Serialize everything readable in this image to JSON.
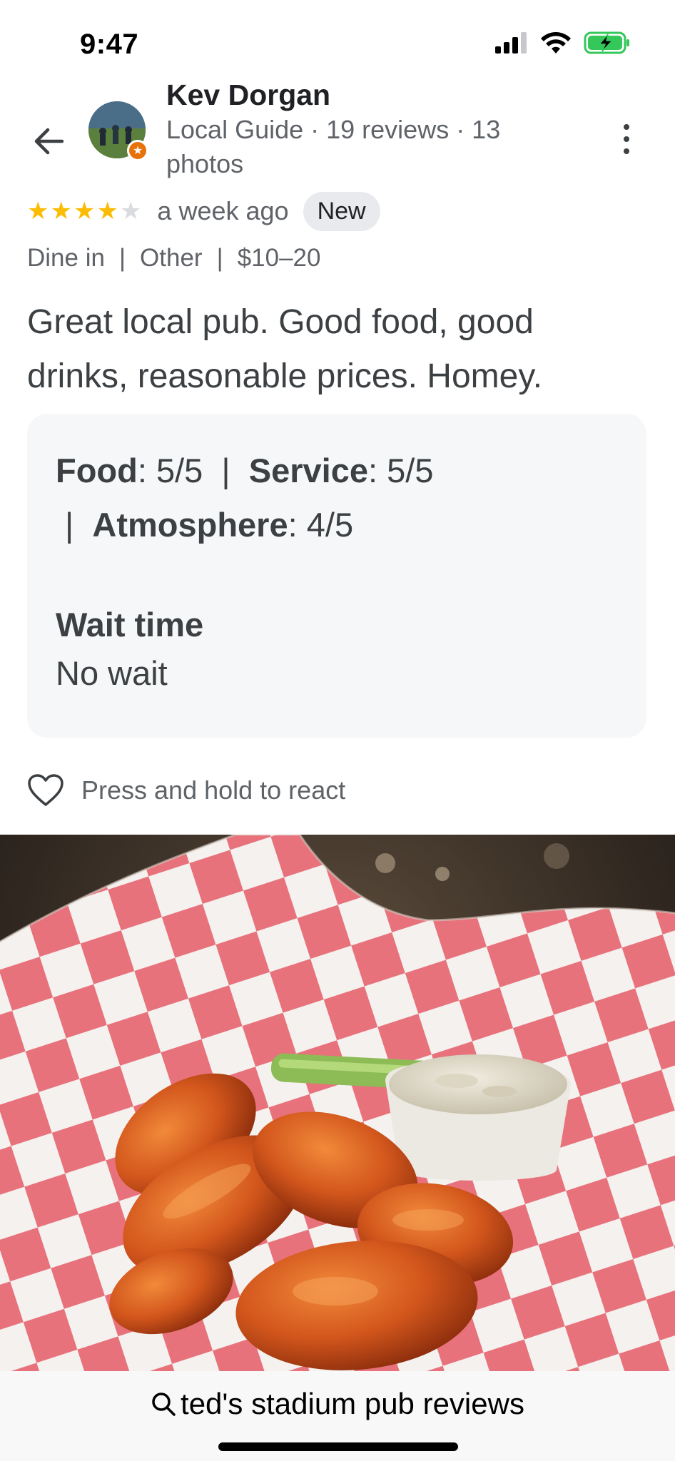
{
  "status_bar": {
    "time": "9:47",
    "icons": [
      "signal-icon",
      "wifi-icon",
      "battery-charging-icon"
    ]
  },
  "header": {
    "back_icon": "arrow-left-icon",
    "reviewer_name": "Kev Dorgan",
    "reviewer_meta": "Local Guide · 19 reviews · 13 photos",
    "more_icon": "more-vertical-icon",
    "badge_icon": "local-guide-star-icon"
  },
  "review": {
    "rating": 4,
    "max_rating": 5,
    "time_ago": "a week ago",
    "new_badge": "New",
    "dining_mode": "Dine in",
    "meal_type": "Other",
    "price_range": "$10–20",
    "text": "Great local pub. Good food, good drinks, reasonable prices. Homey."
  },
  "details": {
    "food_label": "Food",
    "food_value": ": 5/5",
    "service_label": "Service",
    "service_value": ": 5/5",
    "atmosphere_label": "Atmosphere",
    "atmosphere_value": ": 4/5",
    "wait_time_label": "Wait time",
    "wait_time_value": "No wait"
  },
  "react": {
    "icon": "heart-outline-icon",
    "label": "Press and hold to react"
  },
  "photo": {
    "subject": "chicken-wings-photo"
  },
  "bottom_bar": {
    "search_icon": "search-icon",
    "search_text": "ted's stadium pub reviews"
  },
  "colors": {
    "star_on": "#fbbc04",
    "star_off": "#dadce0",
    "text_primary": "#202124",
    "text_secondary": "#5f6368",
    "card_bg": "#f6f7f8",
    "badge_bg": "#e8eaed",
    "guide_badge": "#e8710a"
  }
}
